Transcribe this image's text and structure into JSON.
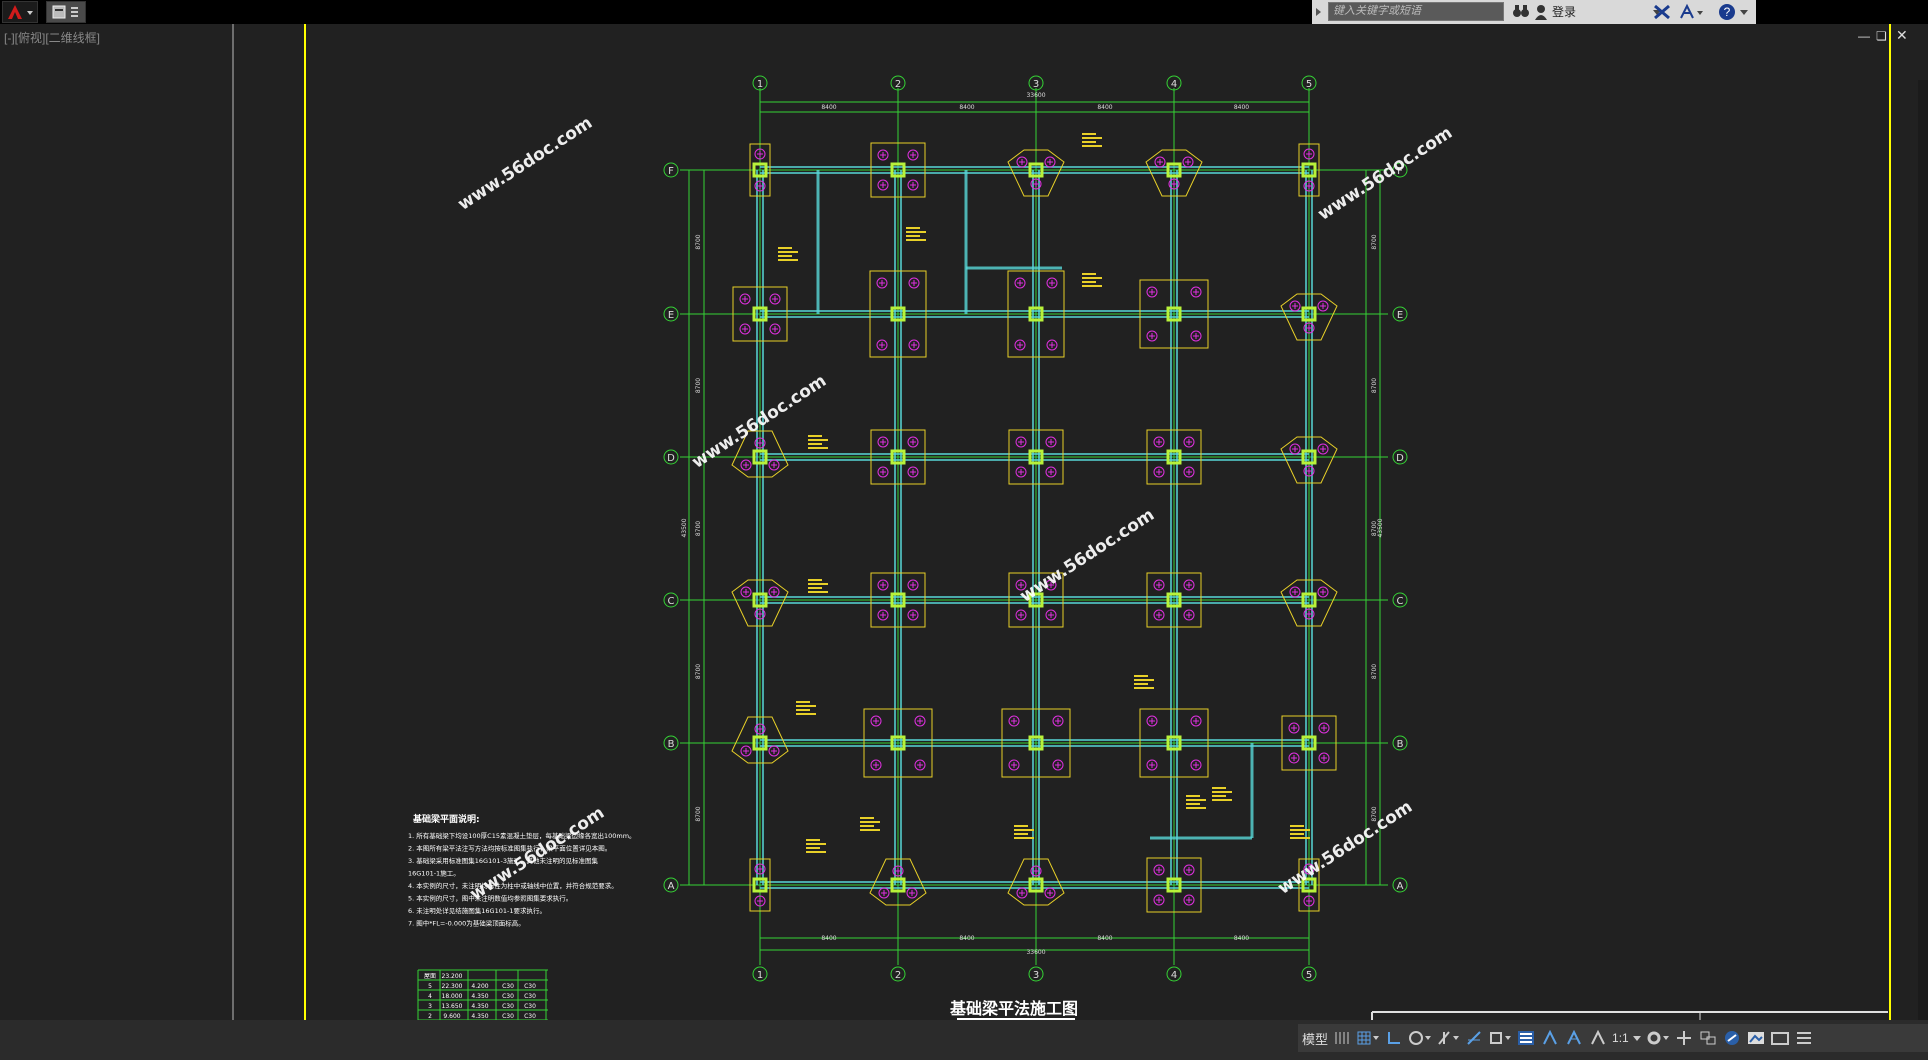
{
  "toolbar": {
    "search_placeholder": "键入关键字或短语",
    "login_label": "登录",
    "help_label": "?"
  },
  "viewport": {
    "label": "[-][俯视][二维线框]"
  },
  "drawing": {
    "title": "基础梁平法施工图",
    "axis_numbers": [
      "1",
      "2",
      "3",
      "4",
      "5"
    ],
    "axis_letters": [
      "F",
      "E",
      "D",
      "C",
      "B",
      "A"
    ],
    "span_labels": [
      "8400",
      "8400",
      "8400",
      "8400"
    ],
    "total_width": "33600",
    "total_height": "43500",
    "side_spans": [
      "8700",
      "8700",
      "8700",
      "8700",
      "8700"
    ],
    "watermark": "www.56doc.com",
    "notes_title": "基础梁平面说明:",
    "notes": [
      "1. 所有基础梁下均设100厚C15素混凝土垫层，每基础梁边缘各宽出100mm。",
      "2. 本图所有梁平法注写方法均按标准图集执行，梁平面位置详见本图。",
      "3. 基础梁采用标准图集16G101-3施工，其他未注明的见标准图集",
      "   16G101-1施工。",
      "4. 本实例的尺寸，未注明均标注为柱中或轴线中位置，并符合规范要求。",
      "5. 本实例的尺寸，图中未注明数值均参照图集要求执行。",
      "6. 未注明处详见结施图集16G101-1要求执行。",
      "7. 图中*FL=-0.000为基础梁顶面标高。"
    ],
    "table": {
      "rows": [
        [
          "屋面",
          "23.200",
          "",
          ""
        ],
        [
          "5",
          "22.300",
          "4.200",
          "C30",
          "C30"
        ],
        [
          "4",
          "18.000",
          "4.350",
          "C30",
          "C30"
        ],
        [
          "3",
          "13.650",
          "4.350",
          "C30",
          "C30"
        ],
        [
          "2",
          "9.600",
          "4.350",
          "C30",
          "C30"
        ]
      ]
    }
  },
  "statusbar": {
    "model_label": "模型",
    "scale_label": "1:1"
  }
}
